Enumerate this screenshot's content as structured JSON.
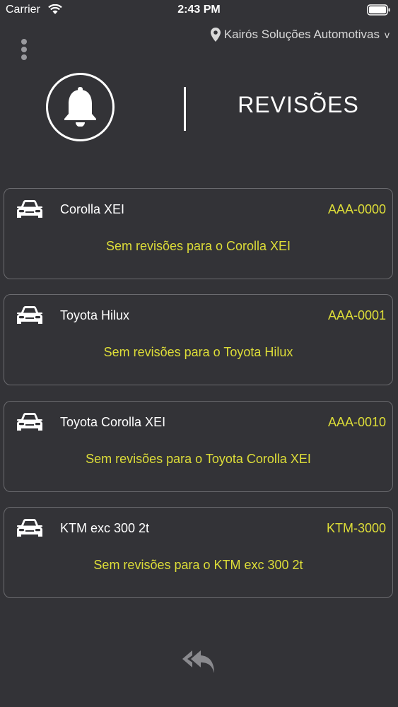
{
  "status_bar": {
    "carrier": "Carrier",
    "time": "2:43 PM"
  },
  "header": {
    "location": "Kairós Soluções Automotivas",
    "location_chevron": "v",
    "title": "REVISÕES"
  },
  "vehicles": [
    {
      "name": "Corolla XEI",
      "plate": "AAA-0000",
      "message": "Sem revisões para o Corolla XEI"
    },
    {
      "name": "Toyota Hilux",
      "plate": "AAA-0001",
      "message": "Sem revisões para o Toyota Hilux"
    },
    {
      "name": "Toyota Corolla XEI",
      "plate": "AAA-0010",
      "message": "Sem revisões para o Toyota Corolla XEI"
    },
    {
      "name": "KTM exc 300 2t",
      "plate": "KTM-3000",
      "message": "Sem revisões para o KTM exc 300 2t"
    }
  ],
  "colors": {
    "background": "#333337",
    "accent": "#dede38",
    "card_border": "#6b6b6f",
    "text": "#ffffff"
  },
  "icons": {
    "menu": "more-vertical-icon",
    "location": "map-pin-icon",
    "header": "bell-icon",
    "vehicle": "car-icon",
    "back": "reply-all-icon"
  }
}
